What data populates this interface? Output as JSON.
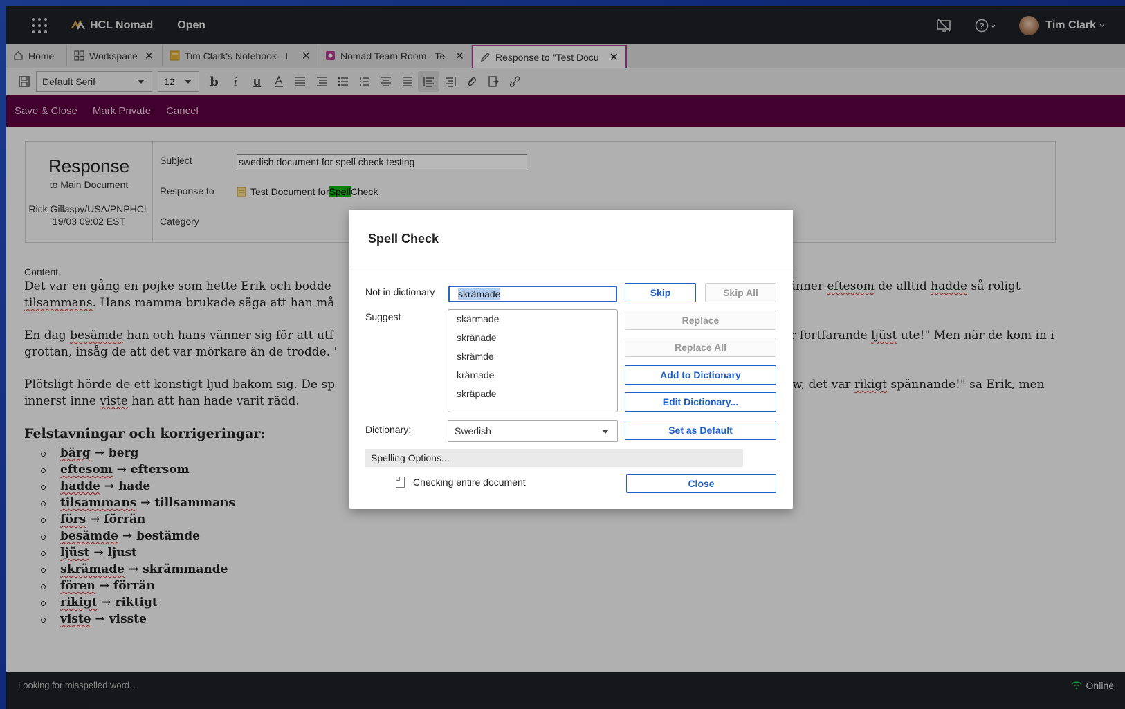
{
  "topbar": {
    "brand": "HCL Nomad",
    "open_label": "Open",
    "user_name": "Tim Clark"
  },
  "tabs": [
    {
      "label": "Home",
      "icon": "home-icon"
    },
    {
      "label": "Workspace",
      "icon": "workspace-icon"
    },
    {
      "label": "Tim Clark's Notebook - I",
      "icon": "notebook-icon"
    },
    {
      "label": "Nomad Team Room - Te",
      "icon": "teamroom-icon"
    },
    {
      "label": "Response to \"Test Docu",
      "icon": "pencil-icon",
      "active": true
    }
  ],
  "toolbar": {
    "font": "Default Serif",
    "size": "12"
  },
  "actions": {
    "save_close": "Save & Close",
    "mark_private": "Mark Private",
    "cancel": "Cancel"
  },
  "header": {
    "title": "Response",
    "subtitle": "to Main Document",
    "author": "Rick Gillaspy/USA/PNPHCL",
    "date": "19/03 09:02 EST",
    "subject_label": "Subject",
    "subject_value": "swedish document for spell check testing",
    "response_to_label": "Response to",
    "response_to_prefix": "Test Document for ",
    "response_to_highlight": "Spell",
    "response_to_suffix": " Check",
    "category_label": "Category"
  },
  "content": {
    "label": "Content",
    "p1_a": "Det var en gång en pojke som hette Erik och bodde",
    "p1_b": "l sina vänner ",
    "p1_c": "eftesom",
    "p1_d": " de alltid ",
    "p1_e": "hadde",
    "p1_f": " så roligt",
    "p1_line2_a": "tilsammans",
    "p1_line2_b": ". Hans mamma brukade säga att han må",
    "p2_a": "En dag ",
    "p2_b": "besämde",
    "p2_c": " han och hans vänner sig för att utf",
    "p2_d": "Det är fortfarande ",
    "p2_e": "ljüst",
    "p2_f": " ute!\" Men när de kom in i",
    "p2_line2": "grottan, insåg de att det var mörkare än de trodde. '",
    "p3_a": "Plötsligt hörde de ett konstigt ljud bakom sig. De sp",
    "p3_b": ". \"Wow, det var ",
    "p3_c": "rikigt",
    "p3_d": " spännande!\" sa Erik, men",
    "p3_line2_a": "innerst inne ",
    "p3_line2_b": "viste",
    "p3_line2_c": " han att han hade varit rädd.",
    "fix_title": "Felstavningar och korrigeringar:",
    "fixes": [
      {
        "wrong": "bärg",
        "right": "berg"
      },
      {
        "wrong": "eftesom",
        "right": "eftersom"
      },
      {
        "wrong": "hadde",
        "right": "hade"
      },
      {
        "wrong": "tilsammans",
        "right": "tillsammans"
      },
      {
        "wrong": "förs",
        "right": "förrän"
      },
      {
        "wrong": "besämde",
        "right": "bestämde"
      },
      {
        "wrong": "ljüst",
        "right": "ljust"
      },
      {
        "wrong": "skrämade",
        "right": "skrämmande"
      },
      {
        "wrong": "fören",
        "right": "förrän"
      },
      {
        "wrong": "rikigt",
        "right": "riktigt"
      },
      {
        "wrong": "viste",
        "right": "visste"
      }
    ],
    "arrow": " → "
  },
  "dialog": {
    "title": "Spell Check",
    "not_in_dict_label": "Not in dictionary",
    "not_in_dict_value": "skrämade",
    "suggest_label": "Suggest",
    "suggestions": [
      "skärmade",
      "skränade",
      "skrämde",
      "krämade",
      "skräpade"
    ],
    "skip": "Skip",
    "skip_all": "Skip All",
    "replace": "Replace",
    "replace_all": "Replace All",
    "add_to_dict": "Add to Dictionary",
    "edit_dict": "Edit Dictionary...",
    "dictionary_label": "Dictionary:",
    "dictionary_value": "Swedish",
    "set_default": "Set as Default",
    "spelling_options": "Spelling Options...",
    "checking_label": "Checking entire document",
    "close": "Close"
  },
  "status": {
    "text": "Looking for misspelled word...",
    "online": "Online"
  },
  "colors": {
    "accent_bar": "#5c0041",
    "dialog_blue": "#1f5fc6",
    "highlight": "#11b111"
  }
}
